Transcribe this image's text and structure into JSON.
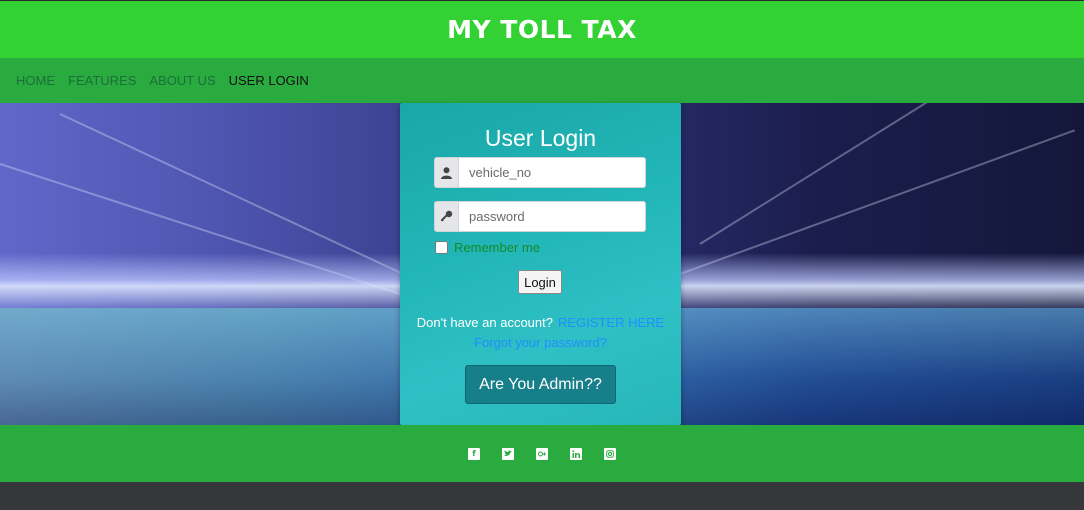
{
  "header": {
    "title": "MY TOLL TAX"
  },
  "nav": {
    "items": [
      {
        "label": "HOME",
        "active": false
      },
      {
        "label": "FEATURES",
        "active": false
      },
      {
        "label": "ABOUT US",
        "active": false
      },
      {
        "label": "USER LOGIN",
        "active": true
      }
    ]
  },
  "login": {
    "title": "User Login",
    "vehicle_placeholder": "vehicle_no",
    "password_placeholder": "password",
    "remember_label": "Remember me",
    "login_button": "Login",
    "no_account_text": "Don't have an account?",
    "register_link": "REGISTER HERE",
    "forgot_link": "Forgot your password?",
    "admin_button": "Are You Admin??"
  },
  "footer": {
    "icons": [
      "facebook-icon",
      "twitter-icon",
      "google-plus-icon",
      "linkedin-icon",
      "instagram-icon"
    ]
  },
  "colors": {
    "header_bg": "#34d134",
    "nav_bg": "#29ab3f",
    "card_bg": "#22b5b7",
    "admin_button_bg": "#177f8a",
    "link": "#1e90ff"
  }
}
